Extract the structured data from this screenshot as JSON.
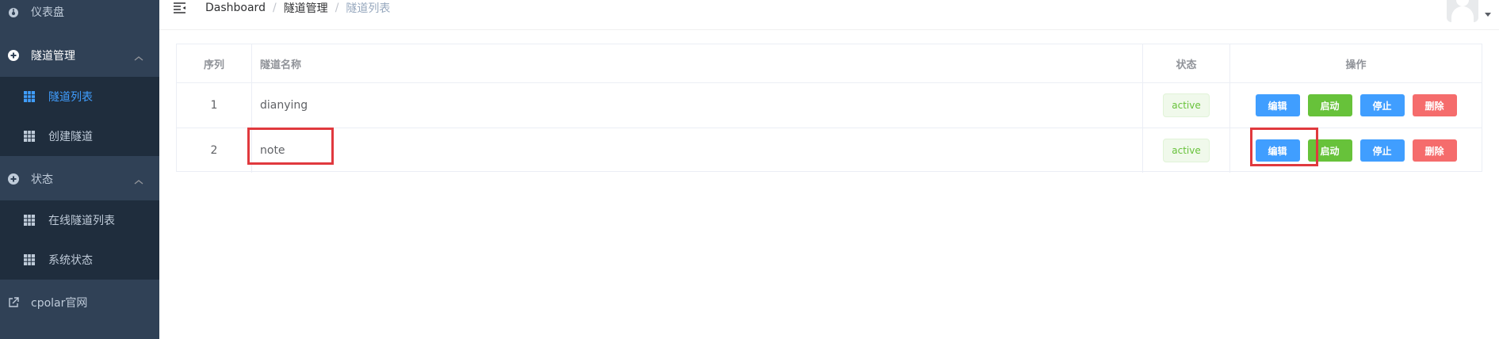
{
  "sidebar": {
    "items": [
      {
        "label": "仪表盘",
        "icon": "dashboard-icon"
      },
      {
        "label": "隧道管理",
        "icon": "plus-circle-icon",
        "expanded": true,
        "children": [
          {
            "label": "隧道列表",
            "icon": "grid-icon",
            "active": true
          },
          {
            "label": "创建隧道",
            "icon": "grid-icon"
          }
        ]
      },
      {
        "label": "状态",
        "icon": "plus-circle-icon",
        "expanded": true,
        "children": [
          {
            "label": "在线隧道列表",
            "icon": "grid-icon"
          },
          {
            "label": "系统状态",
            "icon": "grid-icon"
          }
        ]
      },
      {
        "label": "cpolar官网",
        "icon": "external-link-icon"
      }
    ]
  },
  "navbar": {
    "breadcrumb": [
      "Dashboard",
      "隧道管理",
      "隧道列表"
    ]
  },
  "table": {
    "headers": {
      "index": "序列",
      "name": "隧道名称",
      "status": "状态",
      "ops": "操作"
    },
    "rows": [
      {
        "index": "1",
        "name": "dianying",
        "status": "active"
      },
      {
        "index": "2",
        "name": "note",
        "status": "active"
      }
    ],
    "actions": {
      "edit": "编辑",
      "start": "启动",
      "stop": "停止",
      "delete": "删除"
    }
  },
  "colors": {
    "sidebar_bg": "#304156",
    "submenu_bg": "#1f2d3d",
    "active": "#409eff",
    "success": "#67c23a",
    "danger": "#f56c6c",
    "highlight": "#e0393e"
  }
}
